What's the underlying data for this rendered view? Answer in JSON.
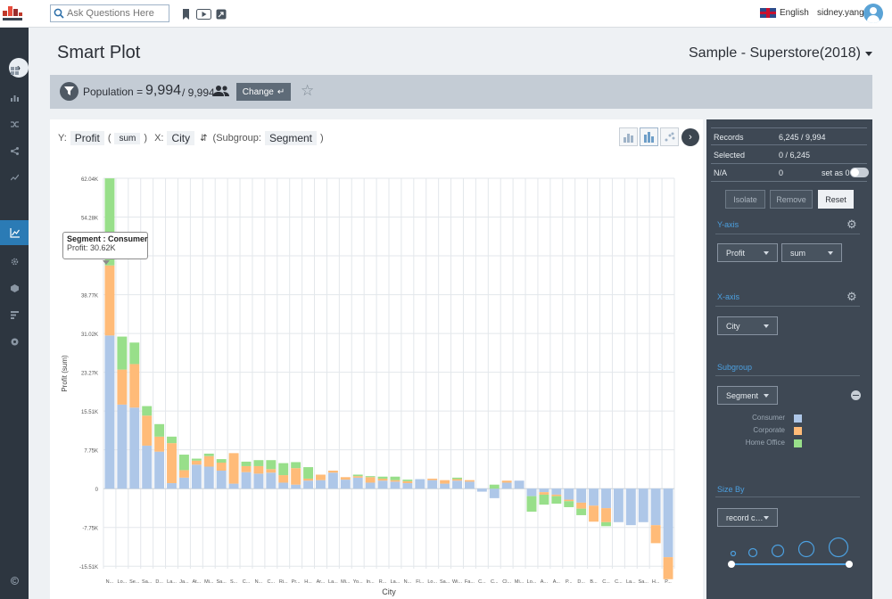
{
  "app": {
    "search_placeholder": "Ask Questions Here",
    "language": "English",
    "username": "sidney.yang"
  },
  "header": {
    "title": "Smart Plot",
    "dataset": "Sample - Superstore(2018)"
  },
  "population": {
    "label": "Population",
    "equals": "=",
    "value": "9,994",
    "total": "/ 9,994",
    "change_label": "Change"
  },
  "controls": {
    "y_label": "Y:",
    "y_field": "Profit",
    "agg_open": "(",
    "y_agg": "sum",
    "agg_close": ")",
    "x_label": "X:",
    "x_field": "City",
    "subgroup_label": "(Subgroup:",
    "subgroup_field": "Segment",
    "subgroup_close": ")"
  },
  "tooltip": {
    "title": "Segment : Consumer",
    "line": "Profit:   30.62K"
  },
  "stats": {
    "records_label": "Records",
    "records_value": "6,245 / 9,994",
    "selected_label": "Selected",
    "selected_value": "0 / 6,245",
    "na_label": "N/A",
    "na_value": "0",
    "set_as_label": "set as 0"
  },
  "actions": {
    "isolate": "Isolate",
    "remove": "Remove",
    "reset": "Reset"
  },
  "yaxis": {
    "title": "Y-axis",
    "field": "Profit",
    "agg": "sum"
  },
  "xaxis": {
    "title": "X-axis",
    "field": "City"
  },
  "subgroup": {
    "title": "Subgroup",
    "field": "Segment",
    "legend": [
      {
        "name": "Consumer",
        "color": "#aec7e8"
      },
      {
        "name": "Corporate",
        "color": "#ffbb78"
      },
      {
        "name": "Home Office",
        "color": "#98df8a"
      }
    ]
  },
  "sizeby": {
    "title": "Size By",
    "field": "record c…"
  },
  "chart_data": {
    "type": "bar",
    "stacked": true,
    "xlabel": "City",
    "ylabel": "Profit (sum)",
    "ylim": [
      -16000,
      62040
    ],
    "yticks": [
      "62.04K",
      "54.28K",
      "46.53K",
      "38.77K",
      "31.02K",
      "23.27K",
      "15.51K",
      "7.75K",
      "0",
      "-7.75K",
      "-15.51K"
    ],
    "categories": [
      "N...",
      "Lo...",
      "Se...",
      "Sa...",
      "D...",
      "La...",
      "Ja...",
      "At...",
      "Mi...",
      "Sa...",
      "S...",
      "C...",
      "N...",
      "C...",
      "Ri...",
      "Pr...",
      "H...",
      "Ar...",
      "La...",
      "Mi...",
      "Yo...",
      "In...",
      "R...",
      "La...",
      "N...",
      "Fl...",
      "Lo...",
      "Sa...",
      "Wi...",
      "Fa...",
      "C...",
      "C...",
      "Cl...",
      "Mi...",
      "Lo...",
      "A...",
      "A...",
      "P...",
      "D...",
      "B...",
      "C...",
      "C...",
      "La...",
      "Sa...",
      "H...",
      "P..."
    ],
    "series": [
      {
        "name": "Consumer",
        "color": "#aec7e8",
        "values": [
          30620,
          16800,
          16200,
          8600,
          7400,
          1100,
          2200,
          4800,
          4400,
          3600,
          1000,
          3300,
          3000,
          3200,
          1200,
          800,
          1600,
          1700,
          3200,
          1800,
          2200,
          1200,
          1600,
          1400,
          1100,
          1900,
          1700,
          1000,
          1600,
          1400,
          -600,
          -1900,
          1200,
          1600,
          -1500,
          -700,
          -1200,
          -2200,
          -2800,
          -3400,
          -3900,
          -6700,
          -7300,
          -6700,
          -7300,
          -13700
        ]
      },
      {
        "name": "Corporate",
        "color": "#ffbb78",
        "values": [
          14000,
          7000,
          8700,
          6000,
          3000,
          8000,
          1500,
          800,
          2100,
          1600,
          6100,
          1200,
          1500,
          700,
          1500,
          3300,
          400,
          1100,
          400,
          500,
          300,
          1100,
          400,
          300,
          400,
          0,
          300,
          700,
          300,
          300,
          0,
          0,
          400,
          0,
          0,
          -500,
          -300,
          -300,
          -1200,
          -3200,
          -2800,
          0,
          0,
          0,
          -3600,
          -4400
        ]
      },
      {
        "name": "Home Office",
        "color": "#98df8a",
        "values": [
          17400,
          6600,
          4300,
          1900,
          2500,
          1300,
          3100,
          400,
          500,
          700,
          0,
          900,
          1200,
          1800,
          2400,
          1200,
          2300,
          0,
          0,
          0,
          300,
          200,
          400,
          700,
          300,
          0,
          0,
          0,
          300,
          0,
          0,
          800,
          0,
          0,
          -3100,
          -2000,
          -1500,
          -1200,
          -1300,
          0,
          -800,
          0,
          0,
          0,
          0,
          0
        ]
      }
    ]
  }
}
